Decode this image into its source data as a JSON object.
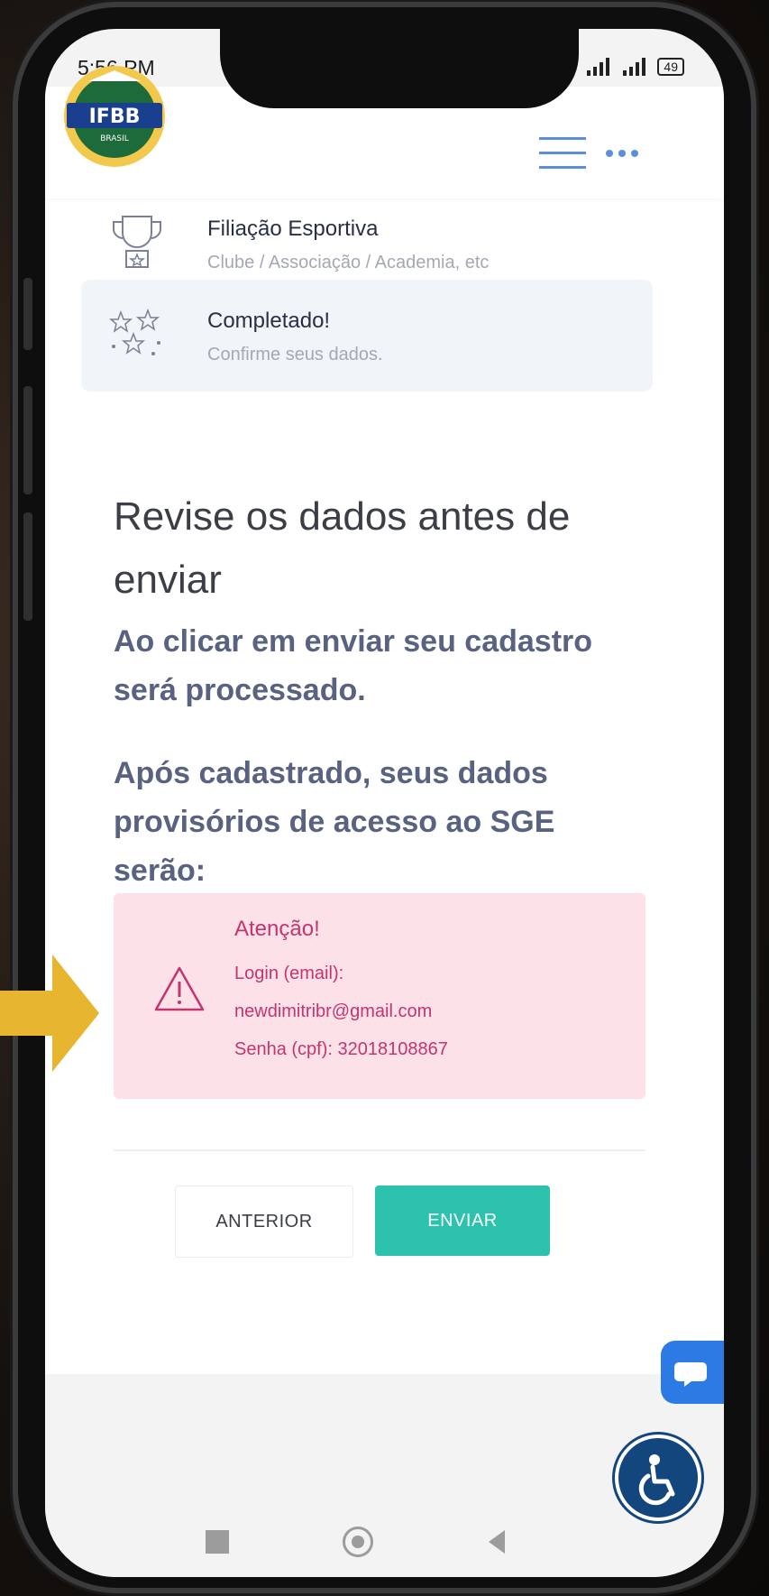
{
  "status_bar": {
    "time": "5:56 PM",
    "battery": "49"
  },
  "header": {
    "logo_text": "IFBB",
    "logo_subtext": "BRASIL",
    "menu_icon": "hamburger-menu-icon",
    "more_icon": "more-dots-icon"
  },
  "steps": [
    {
      "title": "Filiação Esportiva",
      "subtitle": "Clube / Associação / Academia, etc",
      "icon": "trophy-icon",
      "active": false
    },
    {
      "title": "Completado!",
      "subtitle": "Confirme seus dados.",
      "icon": "sparkles-icon",
      "active": true
    }
  ],
  "review": {
    "title": "Revise os dados antes de enviar",
    "note1": "Ao clicar em enviar seu cadastro será processado.",
    "note2": "Após cadastrado, seus dados provisórios de acesso ao SGE serão:"
  },
  "alert": {
    "title": "Atenção!",
    "login_label": "Login (email):",
    "email": "newdimitribr@gmail.com",
    "password_line": "Senha (cpf): 32018108867",
    "icon": "warning-icon"
  },
  "buttons": {
    "previous": "ANTERIOR",
    "send": "ENVIAR"
  },
  "floating": {
    "chat_icon": "chat-bubble-icon",
    "accessibility_icon": "accessibility-icon"
  },
  "colors": {
    "accent_teal": "#2dc2ad",
    "alert_bg": "#fce1e9",
    "alert_text": "#c4356f",
    "note_text": "#596381",
    "chat_blue": "#2c7be5",
    "a11y_blue": "#13467c",
    "arrow_yellow": "#e8b530"
  }
}
